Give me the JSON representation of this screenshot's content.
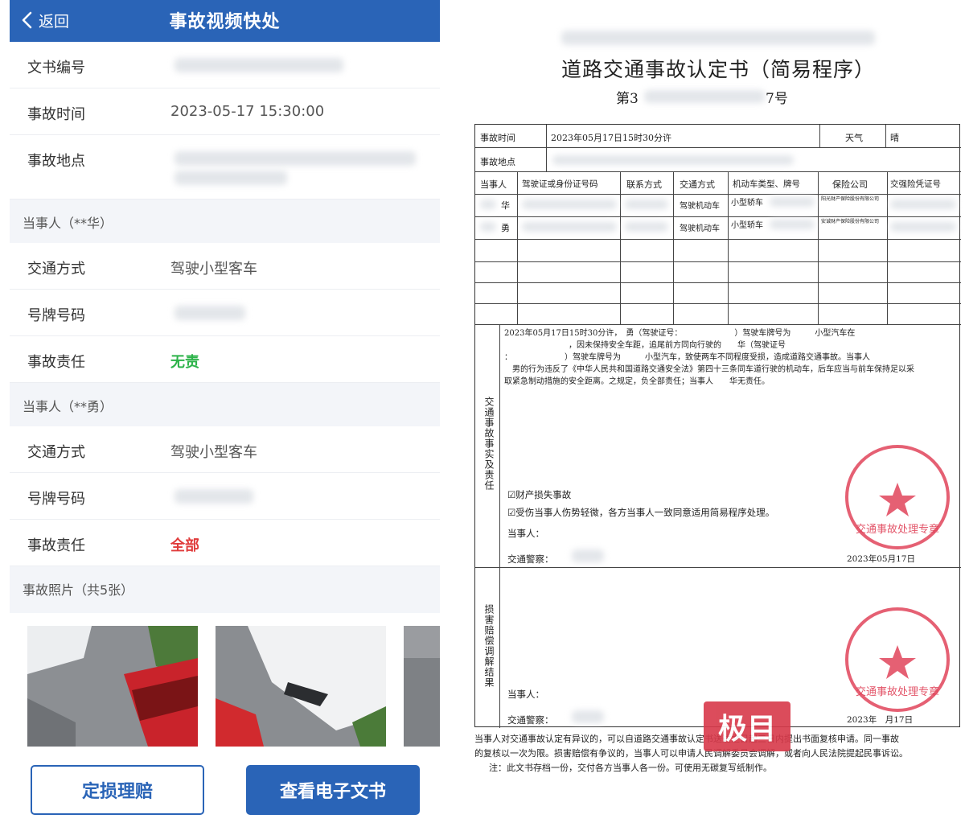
{
  "app": {
    "header": {
      "back_label": "返回",
      "title": "事故视频快处"
    },
    "info": {
      "doc_number_label": "文书编号",
      "time_label": "事故时间",
      "time_value": "2023-05-17 15:30:00",
      "place_label": "事故地点"
    },
    "party1": {
      "section_label": "当事人（**华）",
      "transport_label": "交通方式",
      "transport_value": "驾驶小型客车",
      "plate_label": "号牌号码",
      "liability_label": "事故责任",
      "liability_value": "无责"
    },
    "party2": {
      "section_label": "当事人（**勇）",
      "transport_label": "交通方式",
      "transport_value": "驾驶小型客车",
      "plate_label": "号牌号码",
      "liability_label": "事故责任",
      "liability_value": "全部"
    },
    "photos": {
      "section_label": "事故照片（共5张）",
      "count": 5
    },
    "buttons": {
      "claim": "定损理赔",
      "view_doc": "查看电子文书"
    },
    "colors": {
      "primary": "#2a64b7",
      "no_liability": "#2db34a",
      "full_liability": "#e03b3b"
    }
  },
  "document": {
    "title": "道路交通事故认定书（简易程序）",
    "number_prefix": "第3",
    "number_suffix": "7号",
    "table": {
      "time_label": "事故时间",
      "time_value": "2023年05月17日15时30分许",
      "weather_label": "天气",
      "weather_value": "晴",
      "place_label": "事故地点",
      "headers": [
        "当事人",
        "驾驶证或身份证号码",
        "联系方式",
        "交通方式",
        "机动车类型、牌号",
        "保险公司",
        "交强险凭证号"
      ],
      "rows": [
        {
          "party": "华",
          "transport": "驾驶机动车",
          "vehicle": "小型轿车",
          "insurer": "阳光财产保险股份有限公司"
        },
        {
          "party": "勇",
          "transport": "驾驶机动车",
          "vehicle": "小型轿车",
          "insurer": "安诚财产保险股份有限公司"
        }
      ]
    },
    "facts": {
      "section_label": "交通事故事实及责任",
      "line1": "2023年05月17日15时30分许，　勇（驾驶证号：　　　　　　　）驾驶车牌号为　　　小型汽车在",
      "line2": "　　　　　　　　，因未保持安全车距，追尾前方同向行驶的　　华（驾驶证号",
      "line3": "：　　　　　　　）驾驶车牌号为　　　小型汽车，致使两车不同程度受损，造成道路交通事故。当事人",
      "line4": "　男的行为违反了《中华人民共和国道路交通安全法》第四十三条同车道行驶的机动车，后车应当与前车保持足以采",
      "line5": "取紧急制动措施的安全距离。之规定，负全部责任；当事人　　华无责任。",
      "check1": "☑财产损失事故",
      "check2": "☑受伤当事人伤势轻微，各方当事人一致同意适用简易程序处理。",
      "party_sign": "当事人：",
      "officer_sign": "交通警察：",
      "date": "2023年05月17日"
    },
    "mediation": {
      "section_label": "损害赔偿调解结果",
      "party_sign": "当事人：",
      "officer_sign": "交通警察：",
      "date": "2023年　月17日"
    },
    "stamp_text": "交通事故处理专章",
    "footer": {
      "line1": "当事人对交通事故认定有异议的，可以自道路交通事故认定书送达之日起三日内提出书面复核申请。同一事故",
      "line2": "的复核以一次为限。损害赔偿有争议的，当事人可以申请人民调解委员会调解，或者向人民法院提起民事诉讼。",
      "line3": "注：此文书存档一份，交付各方当事人各一份。可使用无碳复写纸制作。"
    },
    "watermark": {
      "brand": "极目"
    }
  }
}
